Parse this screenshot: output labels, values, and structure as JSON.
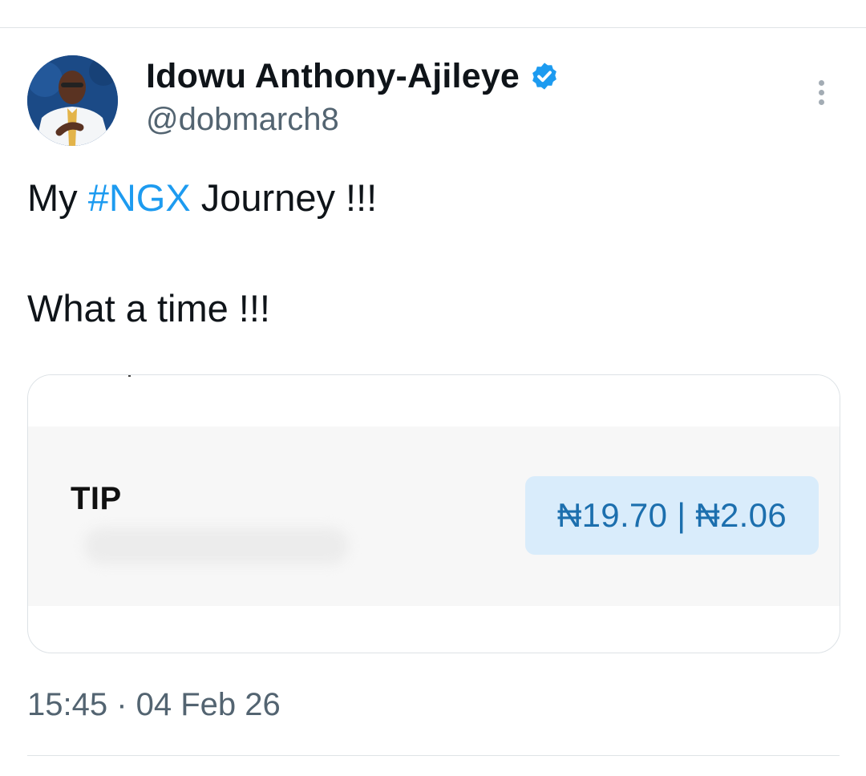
{
  "colors": {
    "accent": "#1d9bf0",
    "text_primary": "#0f1419",
    "text_secondary": "#536471",
    "price_badge_bg": "#d9ecfb",
    "price_text": "#1c6fae"
  },
  "author": {
    "display_name": "Idowu Anthony-Ajileye",
    "handle": "@dobmarch8",
    "verified_icon": "verified-badge-icon",
    "avatar_icon": "profile-photo"
  },
  "menu": {
    "icon": "more-vertical-icon"
  },
  "tweet": {
    "line1_prefix": "My ",
    "line1_hashtag": "#NGX",
    "line1_suffix": " Journey !!!",
    "line2": "What a time !!!"
  },
  "media": {
    "label": "TIP",
    "price": "₦19.70 | ₦2.06"
  },
  "footer": {
    "timestamp": "15:45 · 04 Feb 26"
  }
}
